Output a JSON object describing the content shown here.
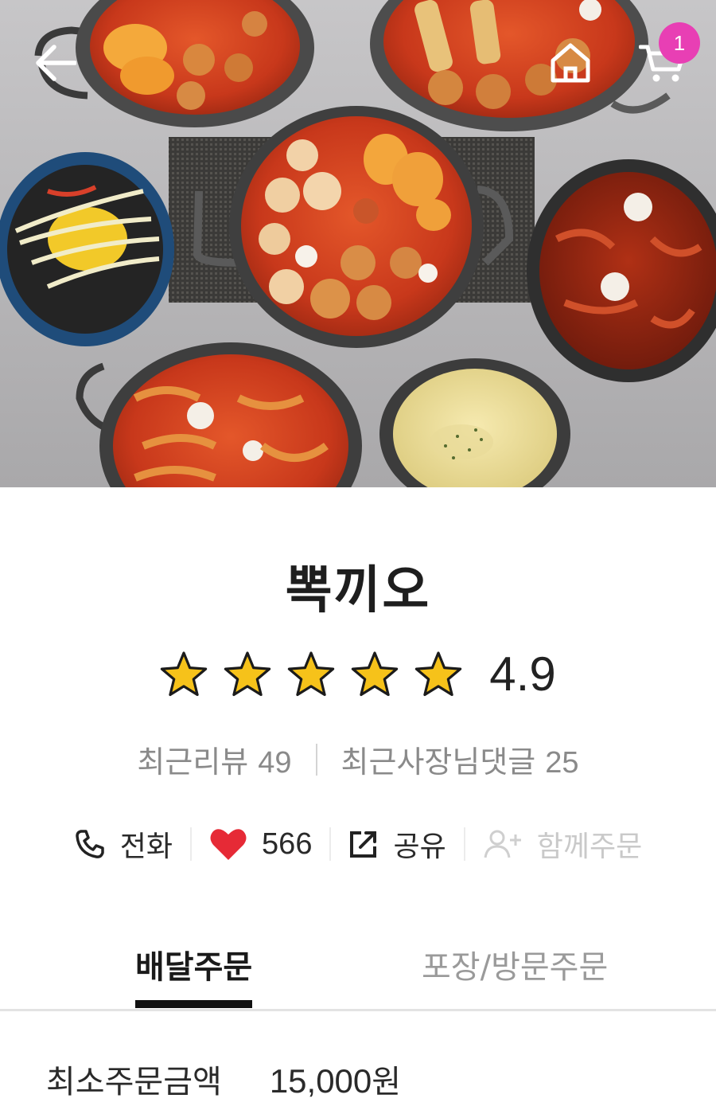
{
  "header": {
    "cart_count": "1",
    "icons": {
      "back": "back-arrow-icon",
      "home": "home-icon",
      "cart": "cart-icon"
    }
  },
  "store": {
    "name": "뽁끼오",
    "rating": "4.9",
    "star_count": 5,
    "recent_reviews_label": "최근리뷰",
    "recent_reviews_count": "49",
    "owner_replies_label": "최근사장님댓글",
    "owner_replies_count": "25"
  },
  "actions": {
    "call_label": "전화",
    "likes_count": "566",
    "share_label": "공유",
    "group_order_label": "함께주문"
  },
  "tabs": {
    "delivery": "배달주문",
    "pickup": "포장/방문주문"
  },
  "order": {
    "min_label": "최소주문금액",
    "min_value": "15,000",
    "currency": "원"
  },
  "colors": {
    "badge": "#e83fb4",
    "heart": "#e62a36",
    "star": "#f6c21a"
  }
}
